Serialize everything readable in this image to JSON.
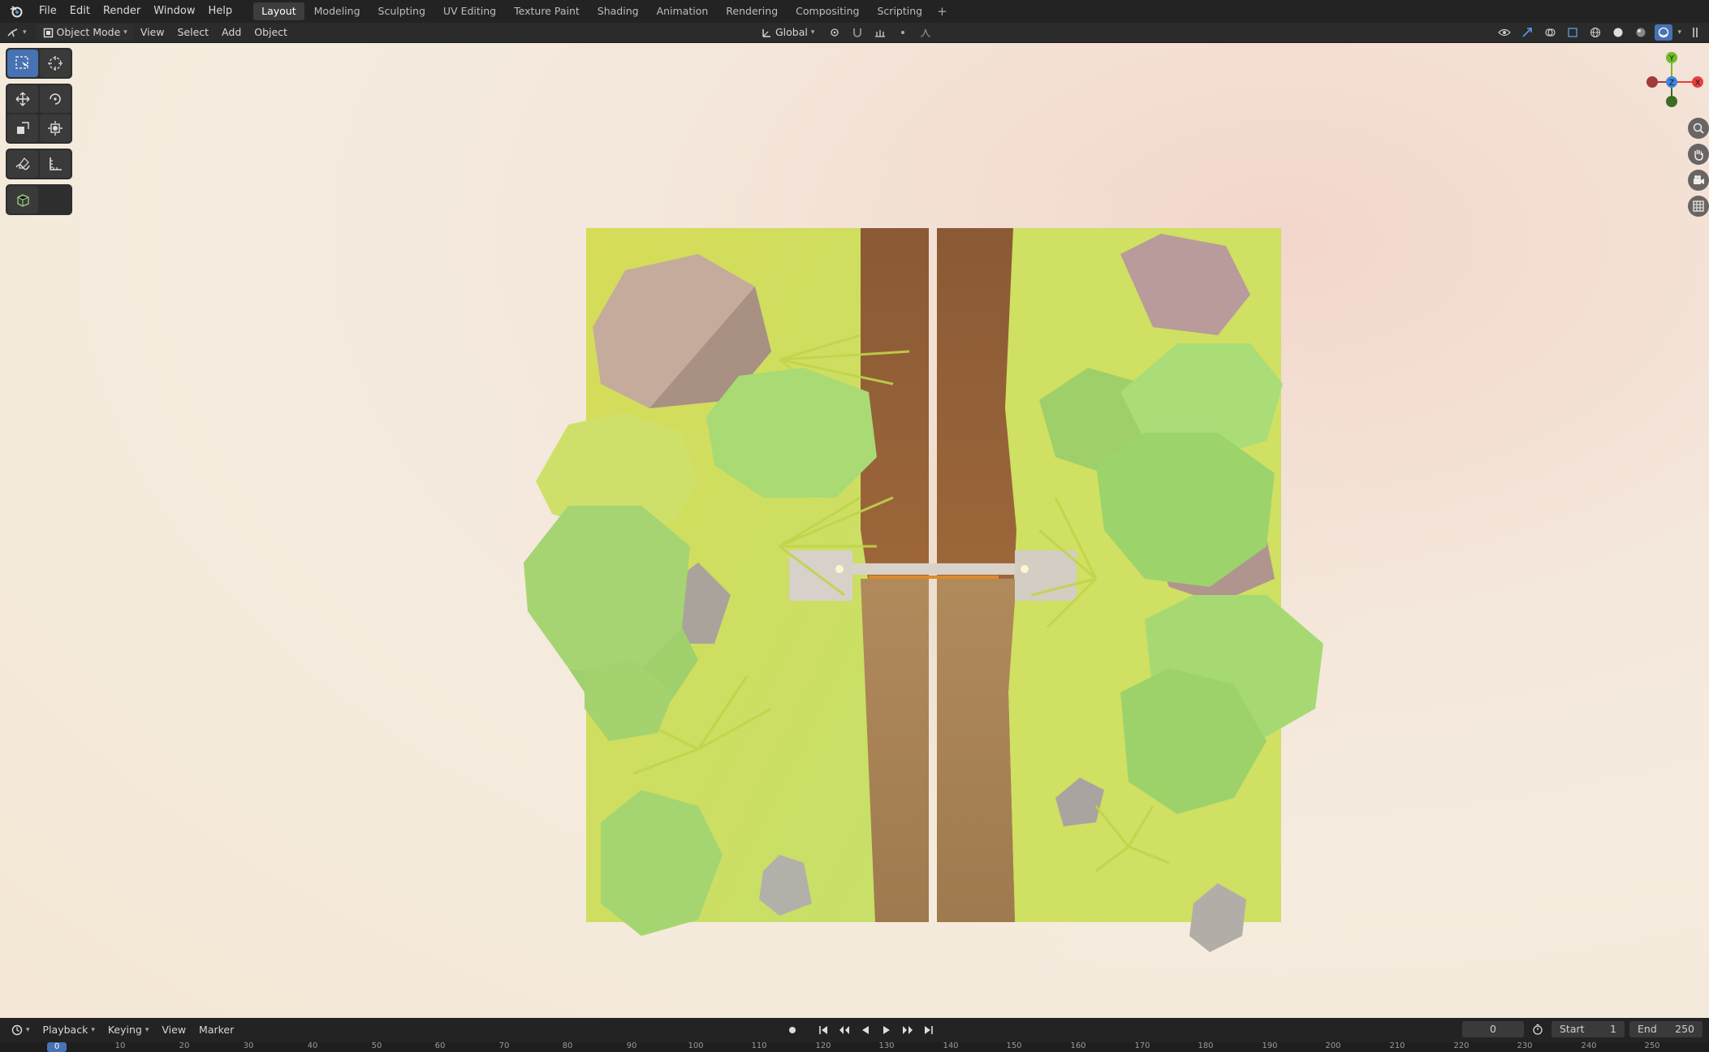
{
  "app": {
    "name": "Blender"
  },
  "topbar": {
    "menus": [
      "File",
      "Edit",
      "Render",
      "Window",
      "Help"
    ],
    "workspaces": [
      "Layout",
      "Modeling",
      "Sculpting",
      "UV Editing",
      "Texture Paint",
      "Shading",
      "Animation",
      "Rendering",
      "Compositing",
      "Scripting"
    ],
    "active_workspace": "Layout",
    "add_label": "+"
  },
  "viewport_header": {
    "mode": "Object Mode",
    "menus": [
      "View",
      "Select",
      "Add",
      "Object"
    ],
    "transform_orientation": "Global"
  },
  "toolbar": {
    "tools": [
      "select-box",
      "cursor",
      "move",
      "rotate",
      "scale",
      "transform",
      "annotate",
      "measure",
      "add-cube"
    ],
    "active_tool": "select-box"
  },
  "gizmo": {
    "x_label": "X",
    "y_label": "Y",
    "z_label": "Z",
    "colors": {
      "x": "#e6413f",
      "y": "#6fbc2c",
      "z": "#3d85e6"
    }
  },
  "scene": {
    "description_colors": {
      "grass": "#c8dc55",
      "road": "#9a6a3e",
      "tree": "#9dd46a",
      "rock": "#b8a49a"
    }
  },
  "timeline": {
    "menus": [
      "Playback",
      "Keying",
      "View",
      "Marker"
    ],
    "current_frame": "0",
    "start_label": "Start",
    "start_value": "1",
    "end_label": "End",
    "end_value": "250",
    "ruler_ticks": [
      "10",
      "20",
      "30",
      "40",
      "50",
      "60",
      "70",
      "80",
      "90",
      "100",
      "110",
      "120",
      "130",
      "140",
      "150",
      "160",
      "170",
      "180",
      "190",
      "200",
      "210",
      "220",
      "230",
      "240",
      "250"
    ],
    "marker_frame": "0"
  }
}
